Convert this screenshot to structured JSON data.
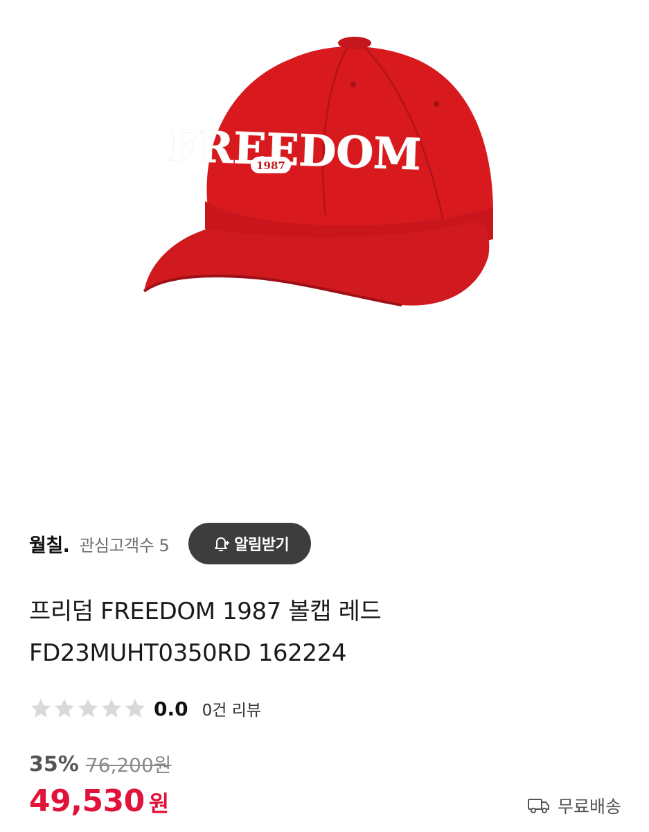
{
  "product_image": {
    "alt": "FREEDOM 1987",
    "cap_text": "FREEDOM",
    "cap_year": "1987",
    "cap_color": "#d81a1e"
  },
  "brand": {
    "name": "월칠.",
    "followers": "관심고객수 5",
    "follow_label": "알림받기",
    "follow_icon": "bell-plus-icon"
  },
  "product": {
    "title_line1": "프리덤 FREEDOM 1987 볼캡 레드",
    "title_line2": "FD23MUHT0350RD 162224"
  },
  "rating": {
    "stars_filled": 0,
    "stars_total": 5,
    "score": "0.0",
    "review_count": "0건 리뷰",
    "star_color_empty": "#d9d9d9"
  },
  "price": {
    "discount_rate": "35%",
    "original": "76,200원",
    "sale": "49,530",
    "currency": "원",
    "sale_color": "#e0133a"
  },
  "shipping": {
    "label": "무료배송",
    "icon": "truck-icon"
  }
}
